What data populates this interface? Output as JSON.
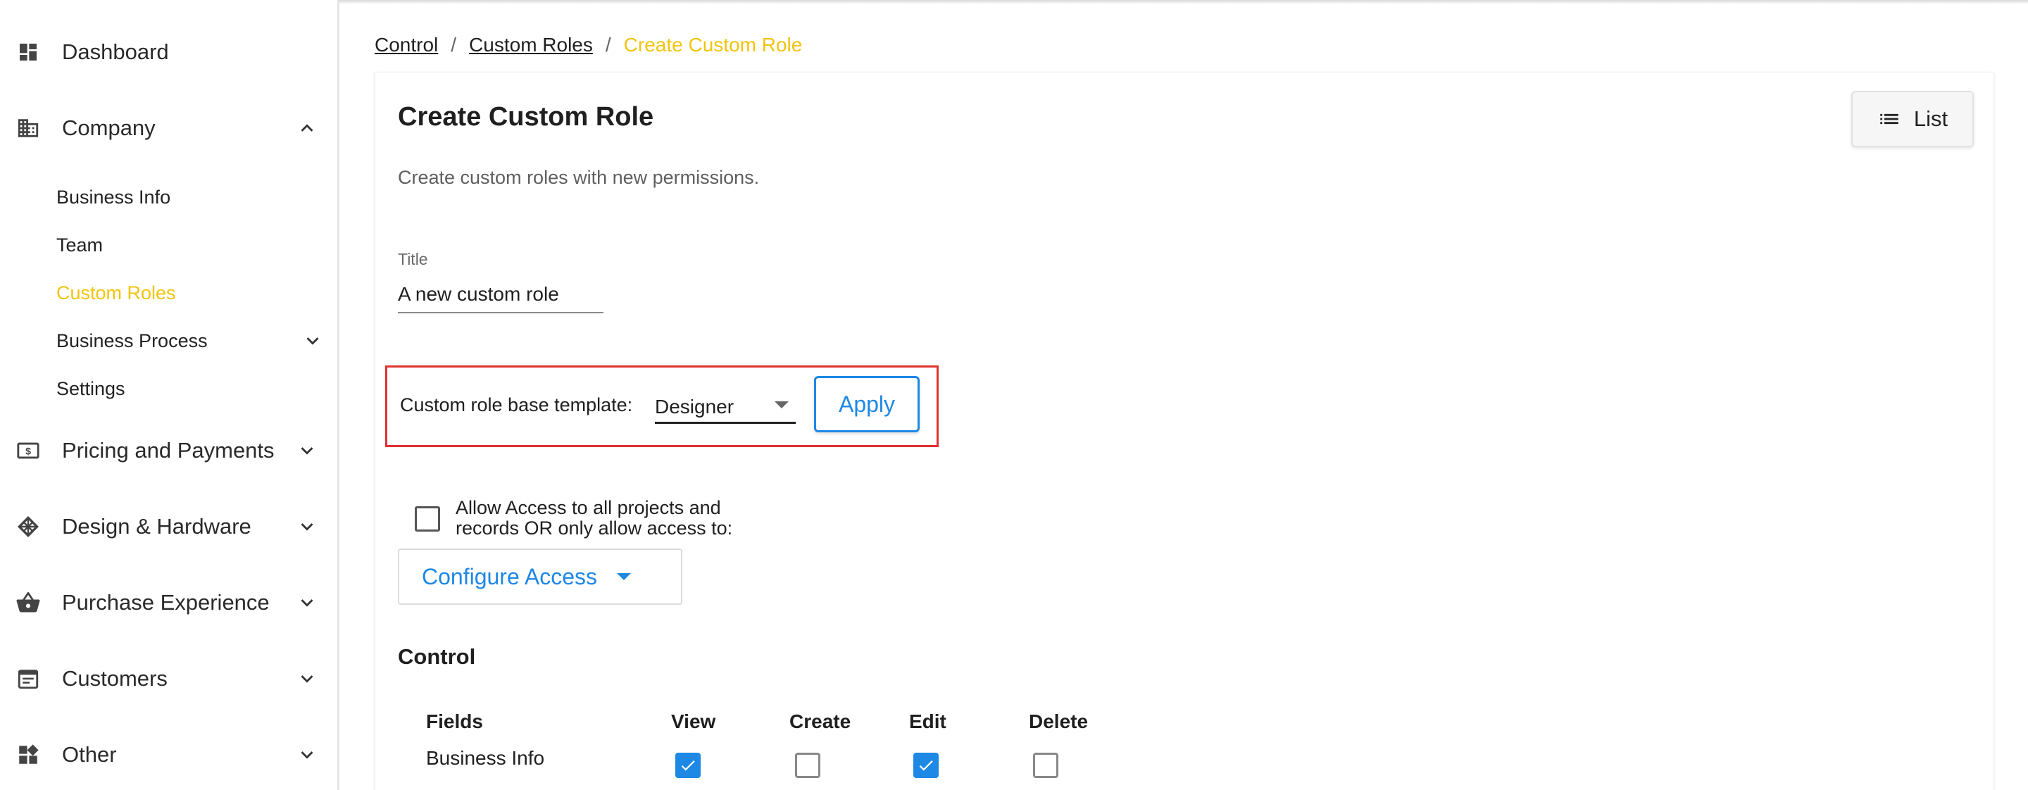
{
  "sidebar": {
    "items": [
      {
        "label": "Dashboard",
        "icon": "dashboard-icon"
      },
      {
        "label": "Company",
        "icon": "building-icon",
        "expanded": true
      },
      {
        "label": "Pricing and Payments",
        "icon": "money-icon"
      },
      {
        "label": "Design & Hardware",
        "icon": "diamond-grid-icon"
      },
      {
        "label": "Purchase Experience",
        "icon": "basket-icon"
      },
      {
        "label": "Customers",
        "icon": "calendar-icon"
      },
      {
        "label": "Other",
        "icon": "widgets-icon"
      }
    ],
    "company_children": [
      {
        "label": "Business Info"
      },
      {
        "label": "Team"
      },
      {
        "label": "Custom Roles",
        "active": true
      },
      {
        "label": "Business Process"
      },
      {
        "label": "Settings"
      }
    ],
    "active_color": "#f2c40f"
  },
  "breadcrumb": {
    "items": [
      "Control",
      "Custom Roles"
    ],
    "separator": "/",
    "current": "Create Custom Role"
  },
  "page": {
    "title": "Create Custom Role",
    "list_button": "List",
    "description": "Create custom roles with new permissions.",
    "title_field": {
      "label": "Title",
      "value": "A new custom role"
    },
    "template": {
      "label": "Custom role base template:",
      "selected": "Designer",
      "apply_label": "Apply"
    },
    "access": {
      "checked": false,
      "line1": "Allow Access to all projects and",
      "line2": "records OR only allow access to:",
      "configure_label": "Configure Access"
    },
    "section_title": "Control",
    "table": {
      "headers": [
        "Fields",
        "View",
        "Create",
        "Edit",
        "Delete"
      ],
      "rows": [
        {
          "label": "Business Info",
          "view": true,
          "create": false,
          "edit": true,
          "delete": false
        }
      ]
    }
  },
  "colors": {
    "accent_blue": "#1e88e5",
    "highlight_red": "#e0322f"
  }
}
